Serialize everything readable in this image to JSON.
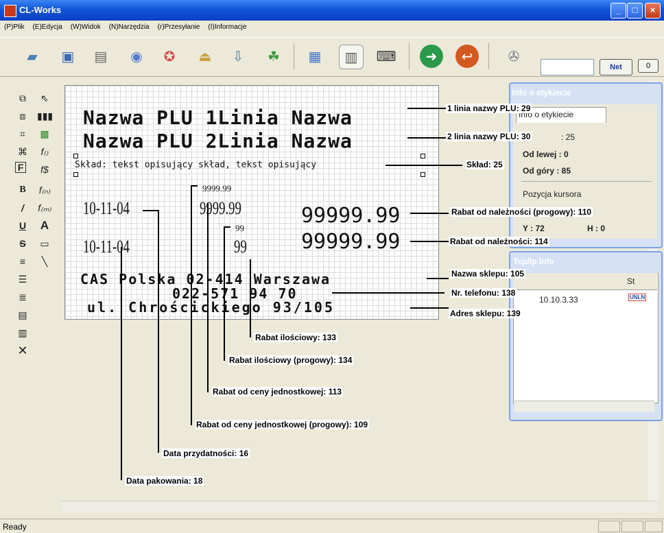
{
  "window": {
    "title": "CL-Works"
  },
  "menu": [
    "(P)Plik",
    "(E)Edycja",
    "(W)Widok",
    "(N)Narzędzia",
    "(r)Przesyłanie",
    "(I)Informacje"
  ],
  "toolbar": {
    "net_label": "Net",
    "zero_label": "0"
  },
  "label": {
    "plu_line1": "Nazwa PLU 1Linia  Nazwa",
    "plu_line2": "Nazwa PLU 2Linia  Nazwa",
    "sklad": "Skład: tekst opisujący skład, tekst opisujący",
    "date1": "10-11-04",
    "date2": "10-11-04",
    "price_small": "9999.99",
    "price_big": "9999.99",
    "qty_small": "99",
    "qty_big": "99",
    "rabat1": "99999.99",
    "rabat2": "99999.99",
    "shop": "CAS Polska 02-414 Warszawa",
    "phone": "022-571 94 70",
    "address": "ul. Chrościckiego 93/105"
  },
  "callouts": {
    "c1": "1 linia nazwy PLU: 29",
    "c2": "2 linia nazwy PLU: 30",
    "c3": "Skład: 25",
    "c4": "Rabat od należności (progowy): 110",
    "c5": "Rabat od należności: 114",
    "c6": "Nazwa sklepu: 105",
    "c7": "Nr. telefonu: 138",
    "c8": "Adres sklepu: 139",
    "c9": "Rabat ilościowy: 133",
    "c10": "Rabat ilościowy (progowy): 134",
    "c11": "Rabat od ceny jednostkowej: 113",
    "c12": "Rabat od ceny jednostkowej (progowy): 109",
    "c13": "Data przydatności: 16",
    "c14": "Data pakowania: 18"
  },
  "info_panel": {
    "title": "Info o etykiecie",
    "tab": "Info o etykiecie",
    "row1": ": 25",
    "od_lewej": "Od lewej : 0",
    "od_gory": "Od góry : 85",
    "pozycja": "Pozycja kursora",
    "y": "Y : 72",
    "h": "H : 0"
  },
  "tcp_panel": {
    "title": "Tcp/Ip Info",
    "col_st": "St",
    "ip": "10.10.3.33",
    "badge": "UNLN"
  },
  "status": {
    "text": "Ready"
  },
  "colors": {
    "titlebar": "#0a3fc4",
    "panel_border": "#7ea1e8"
  }
}
